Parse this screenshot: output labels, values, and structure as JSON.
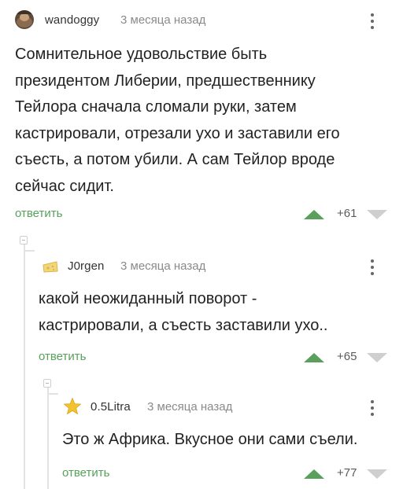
{
  "comments": [
    {
      "username": "wandoggy",
      "time": "3 месяца назад",
      "lines": [
        "Сомнительное удовольствие быть",
        "президентом Либерии, предшественнику",
        "Тейлора сначала сломали руки, затем",
        "кастрировали, отрезали ухо и заставили его",
        "съесть, а потом убили. А сам Тейлор вроде",
        "сейчас сидит."
      ],
      "reply_label": "ответить",
      "score": "+61"
    },
    {
      "username": "J0rgen",
      "time": "3 месяца назад",
      "lines": [
        "какой неожиданный поворот -",
        "кастрировали, а съесть заставили ухо.."
      ],
      "reply_label": "ответить",
      "score": "+65"
    },
    {
      "username": "0.5Litra",
      "time": "3 месяца назад",
      "lines": [
        "Это ж Африка. Вкусное они сами съели."
      ],
      "reply_label": "ответить",
      "score": "+77"
    }
  ],
  "colors": {
    "accent_green": "#58a05c",
    "thread_line": "#e2e2e2",
    "downvote": "#cfcfcf"
  },
  "icons": [
    "avatar-photo",
    "avatar-cheese",
    "star-icon",
    "more-vert-icon",
    "upvote-icon",
    "downvote-icon",
    "collapse-icon"
  ]
}
